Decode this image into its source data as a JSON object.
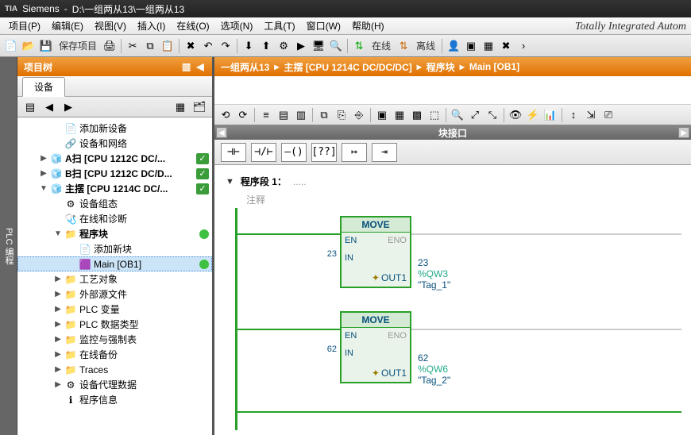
{
  "title": {
    "app": "Siemens",
    "path": "D:\\一组两从13\\一组两从13"
  },
  "menu": [
    "项目(P)",
    "编辑(E)",
    "视图(V)",
    "插入(I)",
    "在线(O)",
    "选项(N)",
    "工具(T)",
    "窗口(W)",
    "帮助(H)"
  ],
  "branding": "Totally Integrated Autom",
  "main_toolbar": {
    "save_project": "保存项目",
    "go_online": "在线",
    "go_offline": "离线"
  },
  "project_tree": {
    "title": "项目树",
    "device_tab": "设备",
    "vertical_tab": "PLC 编程",
    "items": [
      {
        "ind": 2,
        "icon": "📄",
        "label": "添加新设备",
        "tw": "",
        "mark": ""
      },
      {
        "ind": 2,
        "icon": "🔗",
        "label": "设备和网络",
        "tw": "",
        "mark": ""
      },
      {
        "ind": 1,
        "icon": "🧊",
        "label": "A扫 [CPU 1212C DC/...",
        "tw": "▶",
        "bold": true,
        "mark": "check"
      },
      {
        "ind": 1,
        "icon": "🧊",
        "label": "B扫 [CPU 1212C DC/D...",
        "tw": "▶",
        "bold": true,
        "mark": "check"
      },
      {
        "ind": 1,
        "icon": "🧊",
        "label": "主摆 [CPU 1214C DC/...",
        "tw": "▼",
        "bold": true,
        "mark": "check"
      },
      {
        "ind": 2,
        "icon": "⚙",
        "label": "设备组态",
        "tw": "",
        "mark": ""
      },
      {
        "ind": 2,
        "icon": "🩺",
        "label": "在线和诊断",
        "tw": "",
        "mark": ""
      },
      {
        "ind": 2,
        "icon": "📁",
        "label": "程序块",
        "tw": "▼",
        "bold": true,
        "mark": "dot"
      },
      {
        "ind": 3,
        "icon": "📄",
        "label": "添加新块",
        "tw": "",
        "mark": ""
      },
      {
        "ind": 3,
        "icon": "🟪",
        "label": "Main [OB1]",
        "tw": "",
        "mark": "dot",
        "sel": true
      },
      {
        "ind": 2,
        "icon": "📁",
        "label": "工艺对象",
        "tw": "▶",
        "mark": ""
      },
      {
        "ind": 2,
        "icon": "📁",
        "label": "外部源文件",
        "tw": "▶",
        "mark": ""
      },
      {
        "ind": 2,
        "icon": "📁",
        "label": "PLC 变量",
        "tw": "▶",
        "mark": ""
      },
      {
        "ind": 2,
        "icon": "📁",
        "label": "PLC 数据类型",
        "tw": "▶",
        "mark": ""
      },
      {
        "ind": 2,
        "icon": "📁",
        "label": "监控与强制表",
        "tw": "▶",
        "mark": ""
      },
      {
        "ind": 2,
        "icon": "📁",
        "label": "在线备份",
        "tw": "▶",
        "mark": ""
      },
      {
        "ind": 2,
        "icon": "📁",
        "label": "Traces",
        "tw": "▶",
        "mark": ""
      },
      {
        "ind": 2,
        "icon": "⚙",
        "label": "设备代理数据",
        "tw": "▶",
        "mark": ""
      },
      {
        "ind": 2,
        "icon": "ℹ",
        "label": "程序信息",
        "tw": "",
        "mark": ""
      }
    ]
  },
  "breadcrumb": [
    "一组两从13",
    "主摆 [CPU 1214C DC/DC/DC]",
    "程序块",
    "Main [OB1]"
  ],
  "block_interface_label": "块接口",
  "ladder_palette": [
    "⊣⊢",
    "⊣/⊢",
    "–()",
    "[??]",
    "↦",
    "⇥"
  ],
  "network": {
    "title_prefix": "程序段 1：",
    "title_suffix": ".....",
    "comment": "注释",
    "boxes": [
      {
        "name": "MOVE",
        "en": "EN",
        "eno": "ENO",
        "in": "IN",
        "out": "OUT1",
        "in_val": "23",
        "out_val": "23",
        "out_addr": "%QW3",
        "out_tag": "\"Tag_1\""
      },
      {
        "name": "MOVE",
        "en": "EN",
        "eno": "ENO",
        "in": "IN",
        "out": "OUT1",
        "in_val": "62",
        "out_val": "62",
        "out_addr": "%QW6",
        "out_tag": "\"Tag_2\""
      }
    ]
  }
}
